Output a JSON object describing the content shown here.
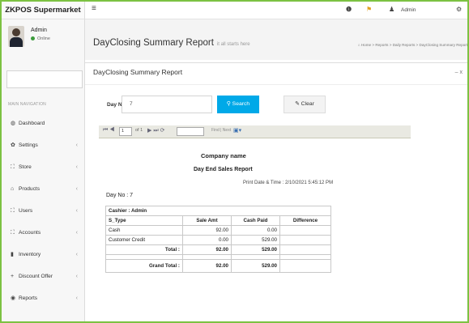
{
  "app": {
    "name": "ZKPOS Supermarket"
  },
  "user": {
    "name": "Admin",
    "status": "Online"
  },
  "sidebar": {
    "nav_header": "MAIN NAVIGATION",
    "items": [
      {
        "label": "Dashboard",
        "icon": "dashboard-icon"
      },
      {
        "label": "Settings",
        "icon": "gear-icon"
      },
      {
        "label": "Store",
        "icon": "sitemap-icon"
      },
      {
        "label": "Products",
        "icon": "tag-icon"
      },
      {
        "label": "Users",
        "icon": "sitemap-icon"
      },
      {
        "label": "Accounts",
        "icon": "sitemap-icon"
      },
      {
        "label": "Inventory",
        "icon": "bars-icon"
      },
      {
        "label": "Discount Offer",
        "icon": "plus-icon"
      },
      {
        "label": "Reports",
        "icon": "eye-icon"
      }
    ]
  },
  "topbar": {
    "user_label": "Admin"
  },
  "header": {
    "title": "DayClosing Summary Report",
    "subtitle": "it all starts here",
    "breadcrumb": [
      "Home",
      "Reports",
      "Daily Reports",
      "DayClosing Summary Report"
    ]
  },
  "box": {
    "title": "DayClosing Summary Report",
    "tools": "–  x"
  },
  "form": {
    "dayno_label": "Day No.",
    "dayno_value": "7",
    "search_label": "Search",
    "clear_label": "Clear"
  },
  "viewer": {
    "page": "1",
    "of_text": "of 1",
    "find_next": "Find | Next"
  },
  "report": {
    "company": "Company name",
    "title": "Day End Sales Report",
    "print_label": "Print Date & Time : 2/10/2021 5:45:12 PM",
    "day_no": "Day No : 7",
    "cashier": "Cashier : Admin",
    "columns": [
      "S_Type",
      "Sale Amt",
      "Cash Paid",
      "Difference"
    ],
    "rows": [
      {
        "type": "Cash",
        "sale": "92.00",
        "paid": "0.00",
        "diff": ""
      },
      {
        "type": "Customer Credit",
        "sale": "0.00",
        "paid": "529.00",
        "diff": ""
      }
    ],
    "total_label": "Total :",
    "total_sale": "92.00",
    "total_paid": "529.00",
    "grand_label": "Grand Total :",
    "grand_sale": "92.00",
    "grand_paid": "529.00"
  }
}
